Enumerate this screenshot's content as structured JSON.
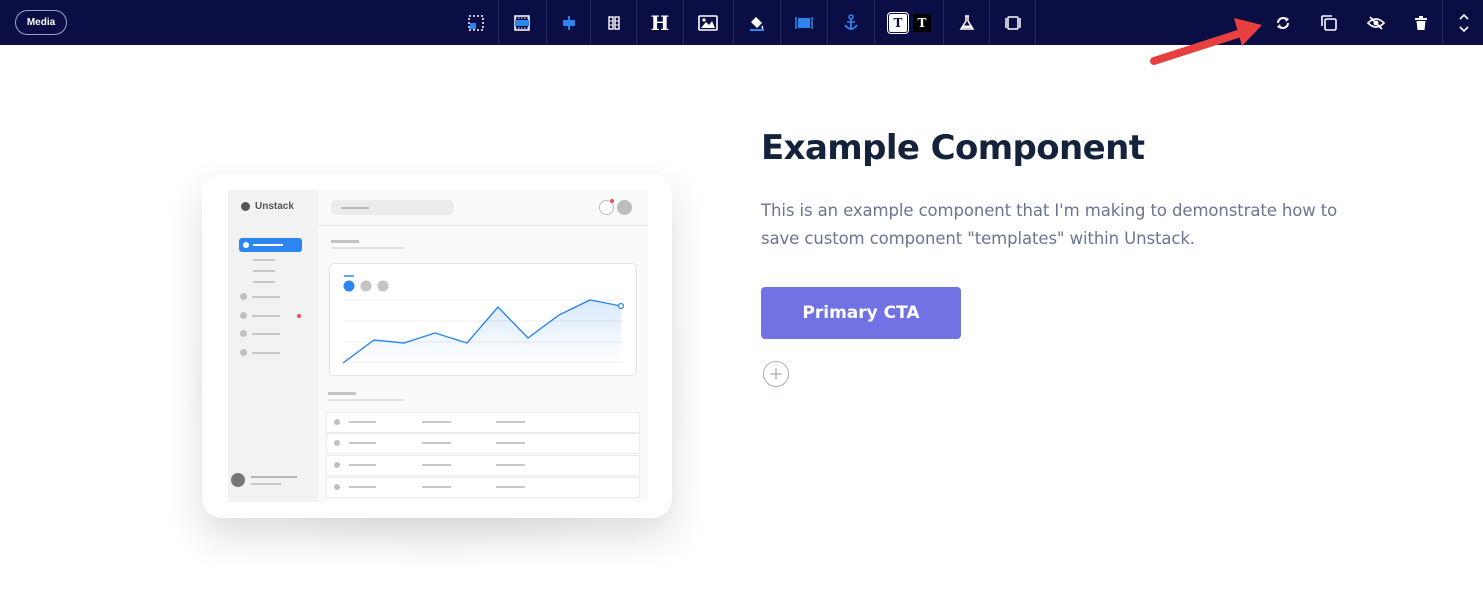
{
  "toolbar": {
    "media_label": "Media",
    "tools": [
      {
        "icon": "select-area-icon"
      },
      {
        "icon": "section-spacing-icon"
      },
      {
        "icon": "alignment-icon"
      },
      {
        "icon": "columns-icon"
      },
      {
        "icon": "heading-icon",
        "glyph": "H"
      },
      {
        "icon": "image-icon"
      },
      {
        "icon": "paint-bucket-icon"
      },
      {
        "icon": "full-width-icon"
      },
      {
        "icon": "anchor-icon"
      },
      {
        "icon": "text-theme-light-icon",
        "glyph": "T"
      },
      {
        "icon": "text-theme-dark-icon",
        "glyph": "T"
      },
      {
        "icon": "ab-test-flask-icon"
      },
      {
        "icon": "width-toggle-icon"
      }
    ],
    "actions": [
      {
        "icon": "refresh-sync-icon"
      },
      {
        "icon": "duplicate-icon"
      },
      {
        "icon": "hide-eye-icon"
      },
      {
        "icon": "trash-icon"
      },
      {
        "icon": "reorder-chevrons-icon"
      }
    ]
  },
  "illustration": {
    "brand_name": "Unstack"
  },
  "content": {
    "heading": "Example Component",
    "body": "This is an example component that I'm making to demonstrate how to save custom component \"templates\" within Unstack.",
    "cta_label": "Primary CTA"
  },
  "colors": {
    "toolbar_bg": "#0b0d45",
    "accent_blue": "#2b86f0",
    "cta_bg": "#7172e4",
    "heading": "#15223b",
    "body_text": "#6a7590",
    "arrow": "#e8403e"
  }
}
